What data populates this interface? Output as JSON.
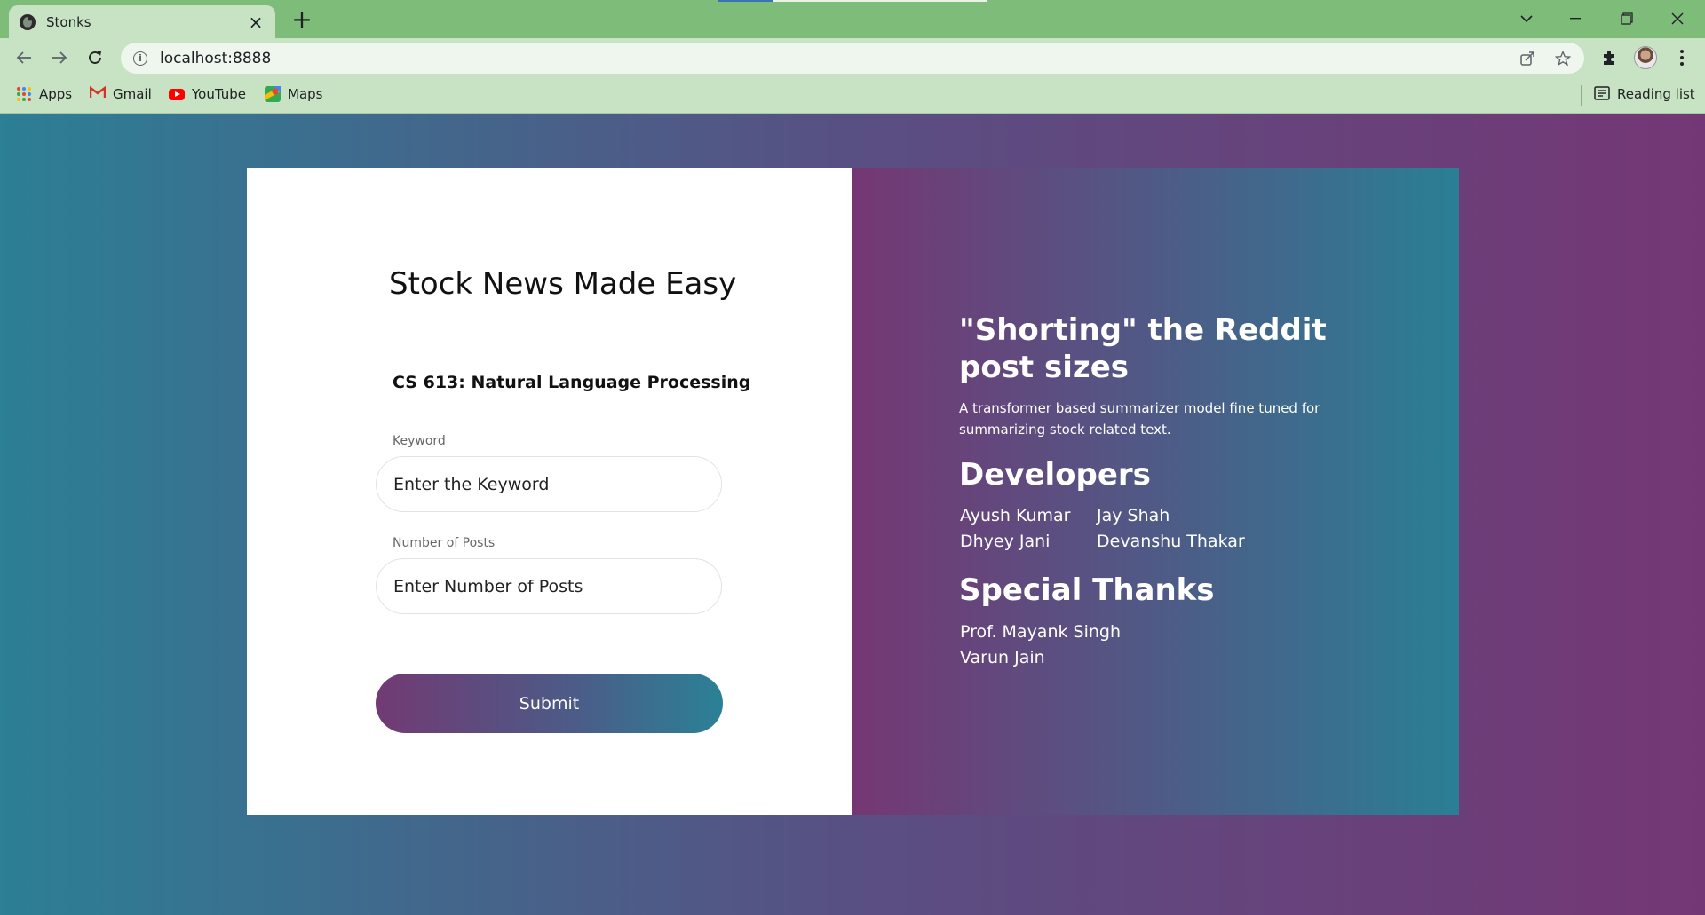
{
  "browser": {
    "tab_title": "Stonks",
    "url": "localhost:8888",
    "bookmarks": [
      "Apps",
      "Gmail",
      "YouTube",
      "Maps"
    ],
    "reading_list": "Reading list"
  },
  "form": {
    "title": "Stock News Made Easy",
    "subtitle": "CS 613: Natural Language Processing",
    "keyword_label": "Keyword",
    "keyword_placeholder": "Enter the Keyword",
    "posts_label": "Number of Posts",
    "posts_placeholder": "Enter Number of Posts",
    "submit_label": "Submit"
  },
  "info": {
    "heading": "\"Shorting\" the Reddit post sizes",
    "description": "A transformer based summarizer model fine tuned for summarizing stock related text.",
    "developers_heading": "Developers",
    "developers": [
      "Ayush Kumar",
      "Jay Shah",
      "Dhyey Jani",
      "Devanshu Thakar"
    ],
    "thanks_heading": "Special Thanks",
    "thanks": [
      "Prof. Mayank Singh",
      "Varun Jain"
    ]
  },
  "colors": {
    "chrome_green": "#7ebc7a",
    "gradient_teal": "#2c7f95",
    "gradient_purple": "#743775"
  }
}
